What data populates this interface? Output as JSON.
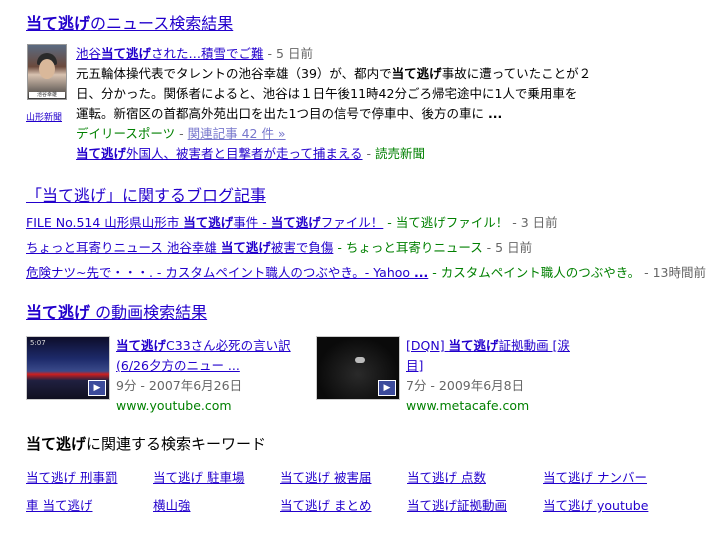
{
  "news": {
    "heading_bold": "当て逃げ",
    "heading_rest": "のニュース検索結果",
    "thumb_source": "山形新聞",
    "thumb_caption": "池谷幸雄",
    "title_pre": "池谷",
    "title_bold": "当て逃げ",
    "title_post": "された…積雪でご難",
    "title_age": "- 5 日前",
    "snippet_l1_pre": "元五輪体操代表でタレントの池谷幸雄（39）が、都内で",
    "snippet_l1_bold": "当て逃げ",
    "snippet_l1_post": "事故に遭っていたことが２",
    "snippet_l2": "日、分かった。関係者によると、池谷は１日午後11時42分ごろ帰宅途中に1人で乗用車を",
    "snippet_l3": "運転。新宿区の首都高外苑出口を出た1つ目の信号で停車中、後方の車に",
    "snippet_l3_ellipsis": "...",
    "source": "デイリースポーツ",
    "related_sep": " - ",
    "related_label": "関連記事 42 件 »",
    "second_bold": "当て逃げ",
    "second_rest": "外国人、被害者と目撃者が走って捕まえる",
    "second_sep": " - ",
    "second_source": "読売新聞"
  },
  "blog": {
    "heading": "「当て逃げ」に関するブログ記事",
    "items": [
      {
        "link_pre": "FILE No.514 山形県山形市 ",
        "link_bold1": "当て逃げ",
        "link_mid": "事件 - ",
        "link_bold2": "当て逃げ",
        "link_post": "ファイル！",
        "source": " - 当て逃げファイル！",
        "age": " - 3 日前"
      },
      {
        "link_pre": "ちょっと耳寄りニュース 池谷幸雄 ",
        "link_bold1": "当て逃げ",
        "link_mid": "被害で負傷",
        "link_bold2": "",
        "link_post": "",
        "source": " - ちょっと耳寄りニュース",
        "age": " - 5 日前"
      },
      {
        "link_pre": "危険ナツ~先で・・・. - カスタムペイント職人のつぶやき。- Yahoo ",
        "link_bold1": "...",
        "link_mid": "",
        "link_bold2": "",
        "link_post": "",
        "source": " - カスタムペイント職人のつぶやき。",
        "age": " - 13時間前"
      }
    ]
  },
  "video": {
    "heading_bold": "当て逃げ",
    "heading_rest": " の動画検索結果",
    "items": [
      {
        "title_bold": "当て逃げ",
        "title_rest": "C33さん必死の言い訳",
        "title_line2": "(6/26夕方のニュー ...",
        "meta": "9分 - 2007年6月26日",
        "site": "www.youtube.com",
        "thumb_text": "5:07"
      },
      {
        "title_pre": "[DQN] ",
        "title_bold": "当て逃げ",
        "title_rest": "証拠動画 [涙",
        "title_line2": "目]",
        "meta": "7分 - 2009年6月8日",
        "site": "www.metacafe.com",
        "thumb_text": ""
      }
    ]
  },
  "related": {
    "heading_bold": "当て逃げ",
    "heading_rest": "に関連する検索キーワード",
    "keywords": [
      [
        "当て逃げ 刑事罰",
        "当て逃げ 駐車場",
        "当て逃げ 被害届",
        "当て逃げ 点数",
        "当て逃げ ナンバー"
      ],
      [
        "車 当て逃げ",
        "横山強",
        "当て逃げ まとめ",
        "当て逃げ証拠動画",
        "当て逃げ youtube"
      ]
    ]
  }
}
